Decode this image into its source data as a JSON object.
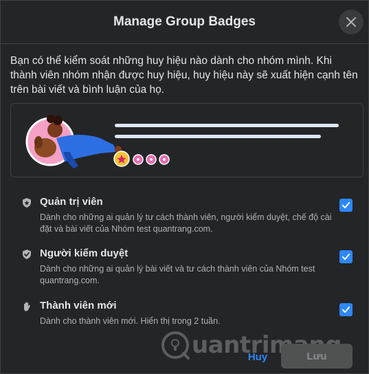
{
  "dialog": {
    "title": "Manage Group Badges",
    "intro": "Bạn có thể kiểm soát những huy hiệu nào dành cho nhóm mình. Khi thành viên nhóm nhận được huy hiệu, huy hiệu này sẽ xuất hiện cạnh tên trên bài viết và bình luận của họ."
  },
  "badges": [
    {
      "title": "Quản trị viên",
      "description": "Dành cho những ai quản lý tư cách thành viên, người kiểm duyệt, chế độ cài đặt và bài viết của Nhóm test quantrang.com.",
      "icon": "admin-shield-star-icon",
      "checked": true
    },
    {
      "title": "Người kiểm duyệt",
      "description": "Dành cho những ai quản lý bài viết và tư cách thành viên của Nhóm test quantrang.com.",
      "icon": "moderator-shield-check-icon",
      "checked": true
    },
    {
      "title": "Thành viên mới",
      "description": "Dành cho thành viên mới. Hiển thị trong 2 tuần.",
      "icon": "waving-hand-icon",
      "checked": true
    }
  ],
  "footer": {
    "cancel_label": "Huy",
    "save_label": "Lưu"
  },
  "watermark": {
    "text": "uantrimang"
  },
  "colors": {
    "background": "#242526",
    "accent": "#2d88ff",
    "text_primary": "#e4e6eb",
    "text_secondary": "#b0b3b8",
    "disabled_button": "#505151"
  }
}
